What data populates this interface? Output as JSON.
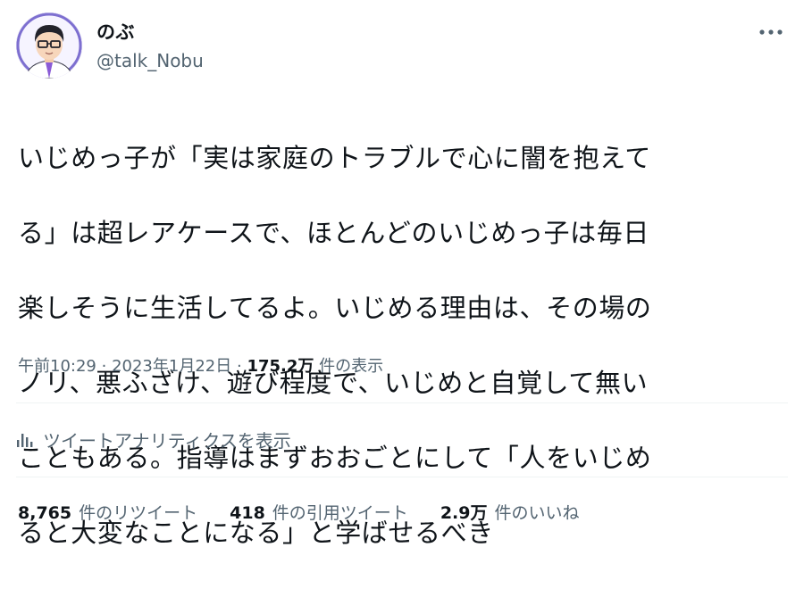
{
  "user": {
    "display_name": "のぶ",
    "handle": "@talk_Nobu",
    "avatar_icon": "cartoon-man-with-glasses-avatar"
  },
  "tweet": {
    "text_lines": [
      "いじめっ子が「実は家庭のトラブルで心に闇を抱えて",
      "る」は超レアケースで、ほとんどのいじめっ子は毎日",
      "楽しそうに生活してるよ。いじめる理由は、その場の",
      "ノリ、悪ふざけ、遊び程度で、いじめと自覚して無い",
      "こともある。指導はまずおおごとにして「人をいじめ",
      "ると大変なことになる」と学ばせるべき"
    ]
  },
  "meta": {
    "time": "午前10:29",
    "separator": "·",
    "date": "2023年1月22日",
    "views_count": "175.2万",
    "views_label": "件の表示"
  },
  "analytics": {
    "label": "ツイートアナリティクスを表示",
    "icon": "bar-chart-icon"
  },
  "stats": {
    "retweets_count": "8,765",
    "retweets_label": "件のリツイート",
    "quotes_count": "418",
    "quotes_label": "件の引用ツイート",
    "likes_count": "2.9万",
    "likes_label": "件のいいね"
  },
  "colors": {
    "text_primary": "#0f1419",
    "text_secondary": "#536471",
    "divider": "#eff3f4",
    "avatar_bg": "#7d6fd0"
  }
}
